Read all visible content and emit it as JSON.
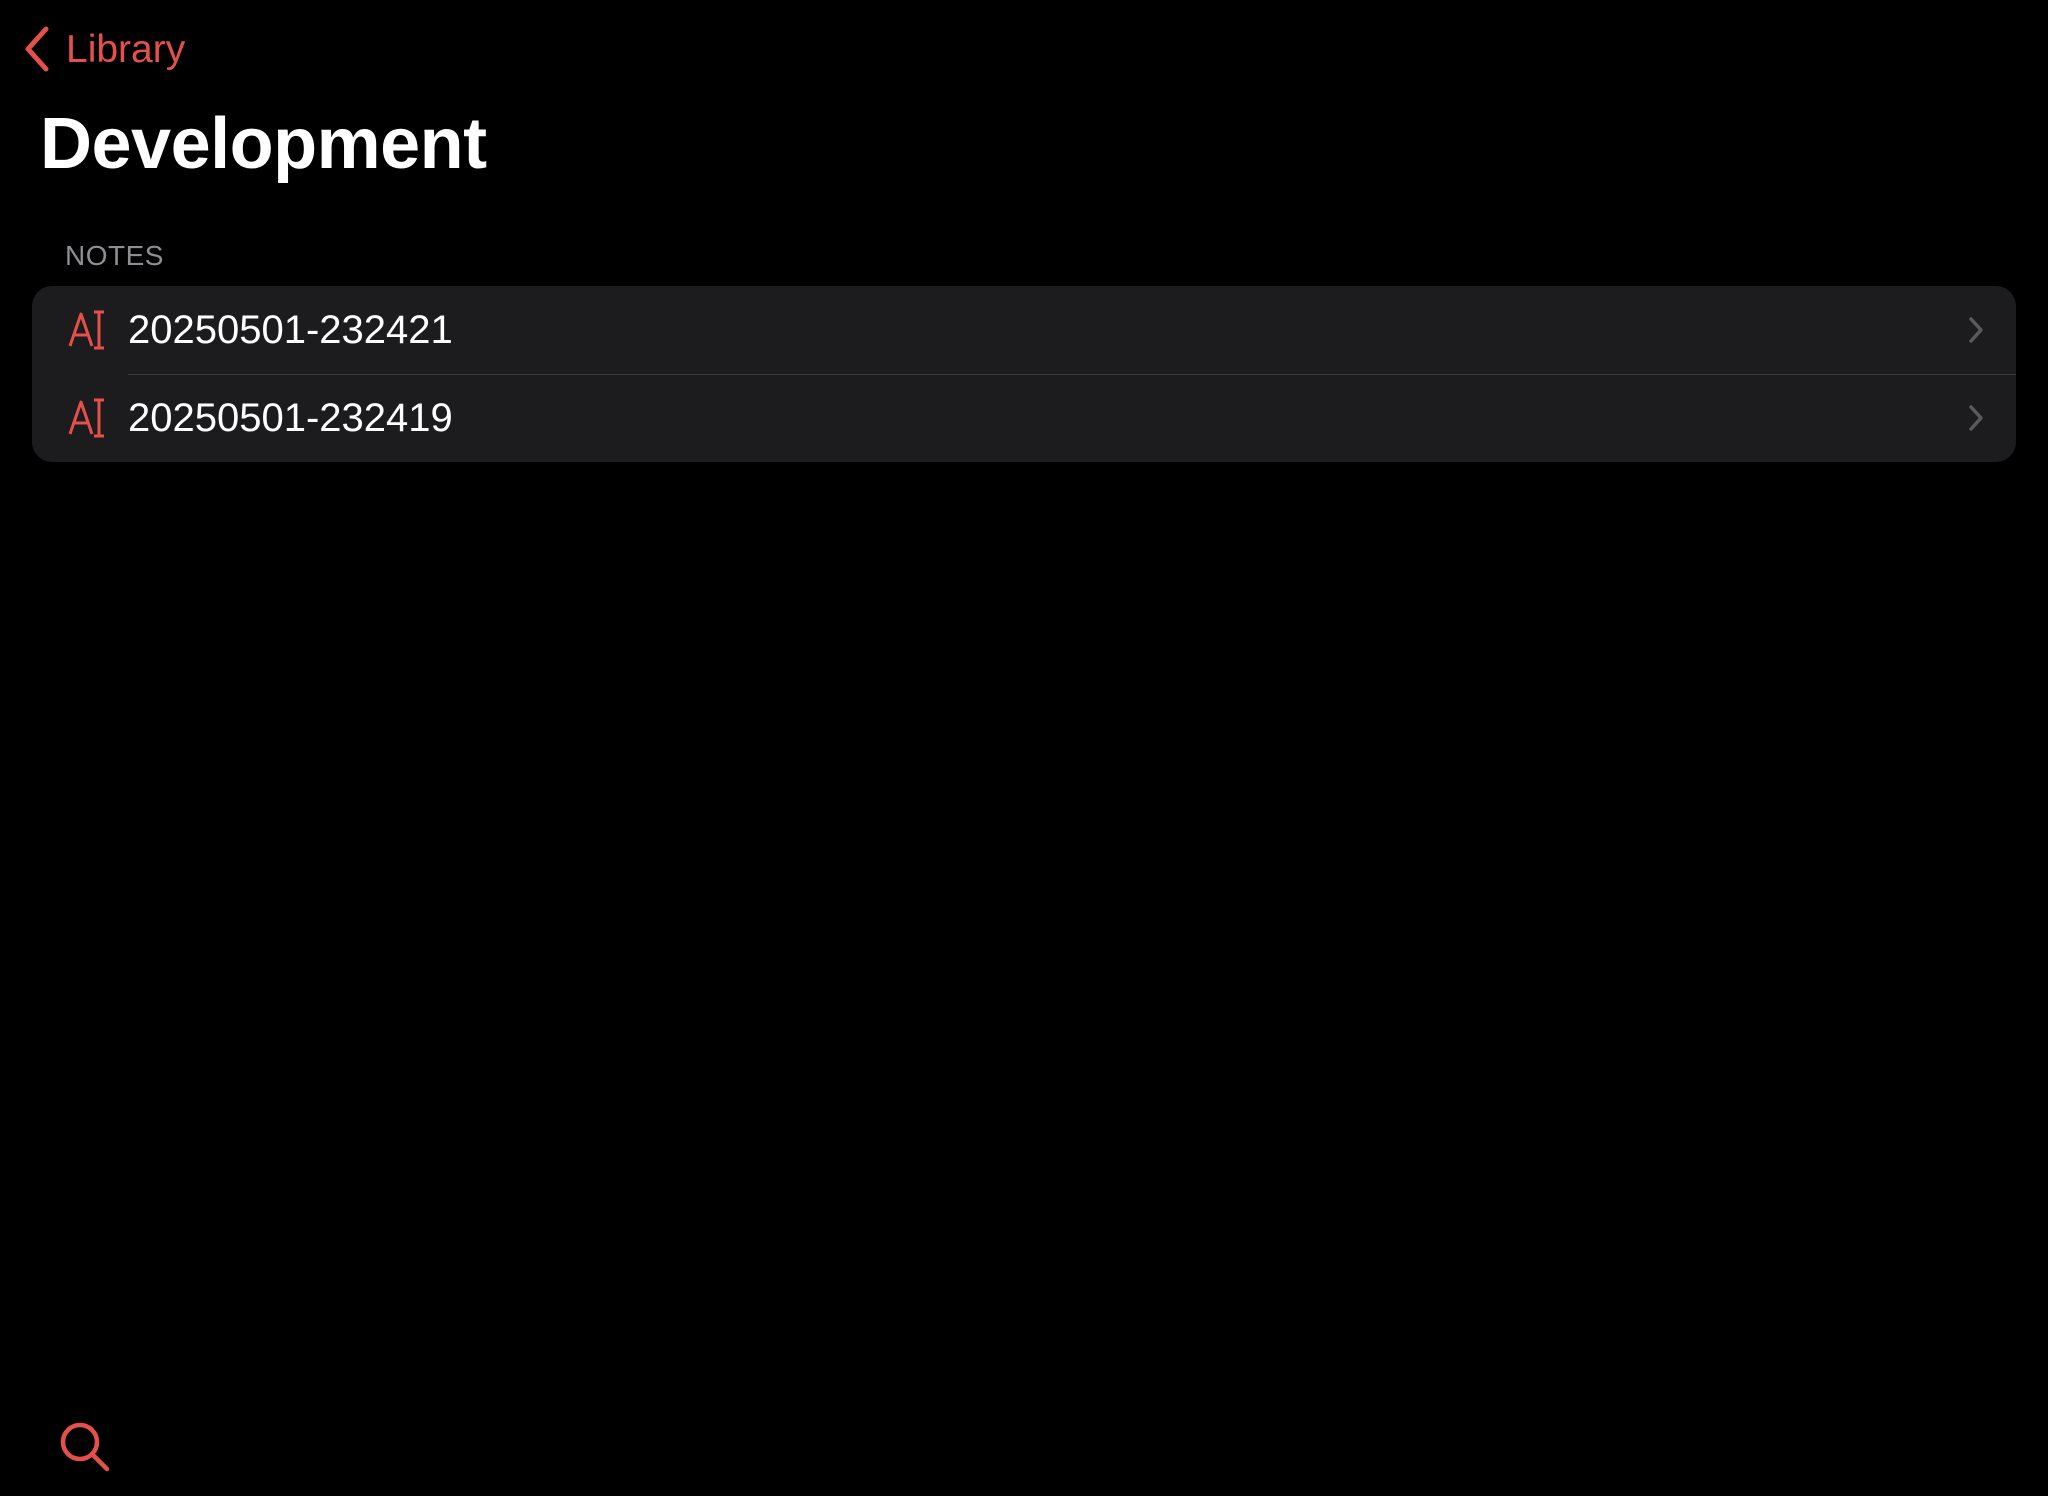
{
  "colors": {
    "accent": "#e5514a",
    "background": "#000000",
    "group_background": "#1c1c1e",
    "separator": "#38383a",
    "secondary_text": "#8e8e93",
    "chevron": "#5a5a5e"
  },
  "nav": {
    "back_label": "Library",
    "back_icon": "chevron-left-icon"
  },
  "page": {
    "title": "Development"
  },
  "notes_section": {
    "header": "NOTES",
    "items": [
      {
        "label": "20250501-232421",
        "icon": "text-note-icon"
      },
      {
        "label": "20250501-232419",
        "icon": "text-note-icon"
      }
    ]
  },
  "toolbar": {
    "search_icon": "search-icon"
  }
}
